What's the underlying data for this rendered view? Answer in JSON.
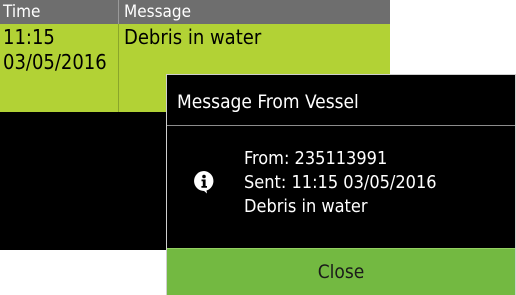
{
  "message_list": {
    "columns": [
      "Time",
      "Message"
    ],
    "rows": [
      {
        "time_line1": "11:15",
        "time_line2": "03/05/2016",
        "message": "Debris in water"
      }
    ]
  },
  "dialog": {
    "title": "Message From Vessel",
    "icon": "info-icon",
    "from": "From: 235113991",
    "sent": "Sent: 11:15 03/05/2016",
    "text": "Debris in water",
    "close_label": "Close"
  },
  "colors": {
    "header_bg": "#6e6e6e",
    "selected_row_bg": "#b2d235",
    "close_button_bg": "#73b941"
  }
}
